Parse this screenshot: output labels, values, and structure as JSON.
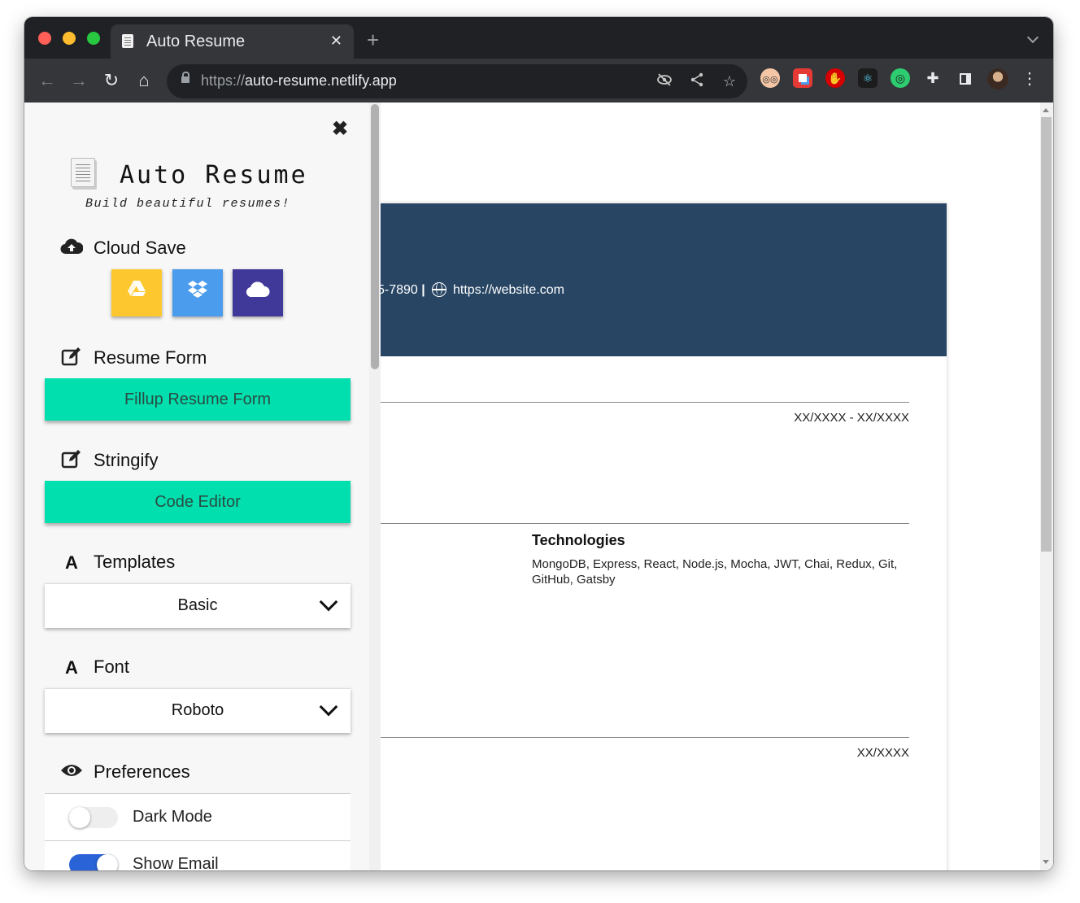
{
  "browser": {
    "tab_title": "Auto Resume",
    "tab_close": "✕",
    "new_tab": "+",
    "url_scheme": "https://",
    "url_host": "auto-resume.netlify.app"
  },
  "sidebar": {
    "close": "✖",
    "title": "Auto Resume",
    "tagline": "Build beautiful resumes!",
    "cloud_save": {
      "heading": "Cloud Save",
      "buttons": [
        "google-drive",
        "dropbox",
        "cloud"
      ]
    },
    "resume_form": {
      "heading": "Resume Form",
      "button": "Fillup Resume Form"
    },
    "stringify": {
      "heading": "Stringify",
      "button": "Code Editor"
    },
    "templates": {
      "heading": "Templates",
      "icon_letter": "A",
      "selected": "Basic"
    },
    "font": {
      "heading": "Font",
      "icon_letter": "A",
      "selected": "Roboto"
    },
    "preferences": {
      "heading": "Preferences",
      "items": [
        {
          "label": "Dark Mode",
          "enabled": false
        },
        {
          "label": "Show Email",
          "enabled": true
        }
      ]
    }
  },
  "resume": {
    "header_color": "#284664",
    "phone_fragment": "5-7890",
    "separator": "|",
    "website": "https://website.com",
    "date_range_1": "XX/XXXX - XX/XXXX",
    "tech_title": "Technologies",
    "tech_list": "MongoDB, Express, React, Node.js, Mocha, JWT, Chai, Redux, Git, GitHub, Gatsby",
    "date_2": "XX/XXXX"
  },
  "colors": {
    "accent_teal": "#00dfad",
    "gdrive_yellow": "#fdc82f",
    "dropbox_blue": "#4b9ced",
    "cloud_indigo": "#41399a",
    "toggle_on": "#2a63d7"
  }
}
